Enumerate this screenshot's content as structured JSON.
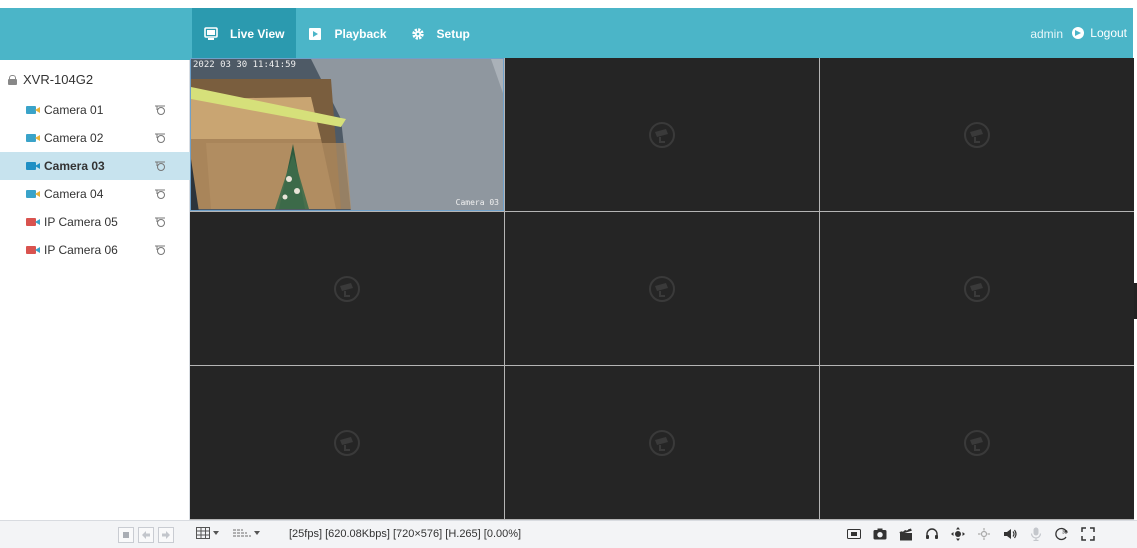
{
  "header": {
    "tabs": [
      {
        "label": "Live View",
        "icon": "monitor-icon",
        "active": true
      },
      {
        "label": "Playback",
        "icon": "play-icon",
        "active": false
      },
      {
        "label": "Setup",
        "icon": "gear-icon",
        "active": false
      }
    ],
    "user": "admin",
    "logout_label": "Logout"
  },
  "sidebar": {
    "device_name": "XVR-104G2",
    "cameras": [
      {
        "label": "Camera 01",
        "status": "analog",
        "selected": false
      },
      {
        "label": "Camera 02",
        "status": "analog",
        "selected": false
      },
      {
        "label": "Camera 03",
        "status": "streaming",
        "selected": true
      },
      {
        "label": "Camera 04",
        "status": "analog",
        "selected": false
      },
      {
        "label": "IP Camera 05",
        "status": "offline",
        "selected": false
      },
      {
        "label": "IP Camera 06",
        "status": "offline",
        "selected": false
      }
    ]
  },
  "video": {
    "live_cell": {
      "timestamp": "2022 03 30 11:41:59",
      "channel_name": "Camera 03"
    },
    "cell_count": 9
  },
  "toolbar": {
    "stream_info": "[25fps] [620.08Kbps] [720×576] [H.265] [0.00%]",
    "right_icons": [
      "snapshot-window-icon",
      "camera-icon",
      "record-clapper-icon",
      "headset-icon",
      "ptz-icon",
      "zoom-icon",
      "speaker-icon",
      "microphone-icon",
      "digital-zoom-icon",
      "fullscreen-icon"
    ]
  },
  "colors": {
    "header": "#4bb5c8",
    "header_active": "#2b9aaf",
    "selected_row": "#c7e3ee",
    "video_bg": "#252525"
  }
}
